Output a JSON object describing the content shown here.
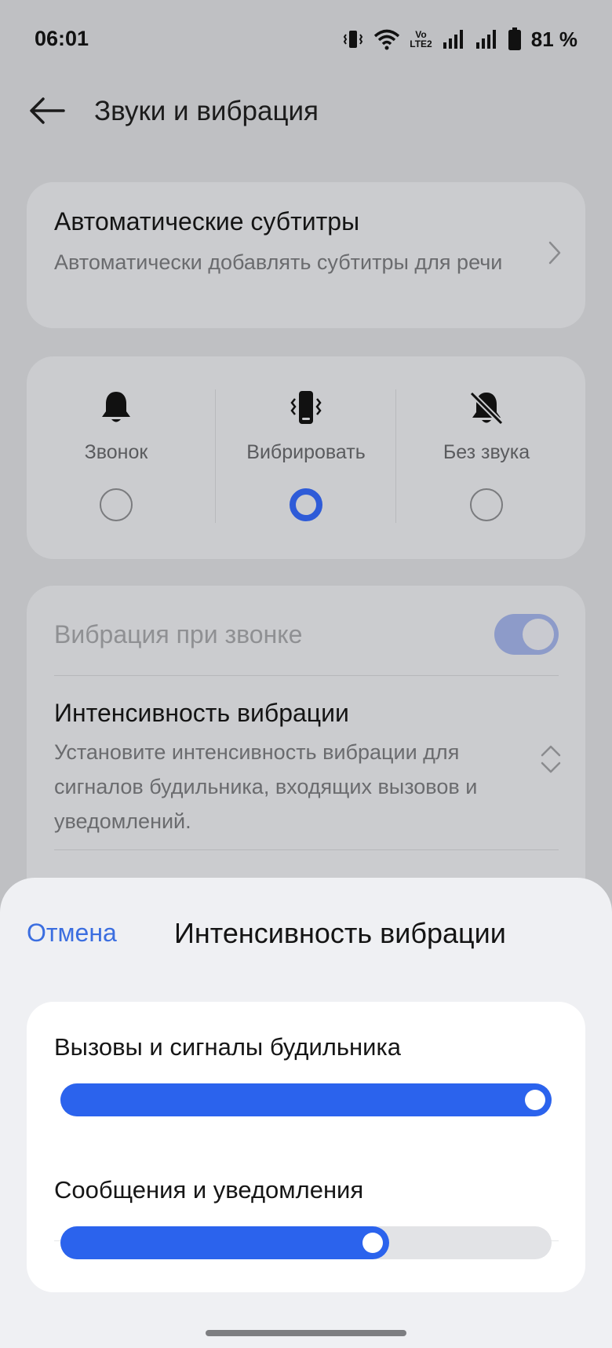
{
  "status_bar": {
    "time": "06:01",
    "volte_top": "Vo",
    "volte_bottom": "LTE2",
    "battery_percent": "81 %",
    "icons": [
      "vibrate-status-icon",
      "wifi-icon",
      "volte-icon",
      "signal-icon",
      "signal-icon",
      "battery-icon"
    ]
  },
  "header": {
    "back_icon": "arrow-left-icon",
    "title": "Звуки и вибрация"
  },
  "auto_subtitles": {
    "title": "Автоматические субтитры",
    "subtitle": "Автоматически добавлять субтитры для речи",
    "icon": "chevron-right-icon"
  },
  "sound_modes": {
    "selected": "Вибрировать",
    "items": [
      {
        "label": "Звонок",
        "icon": "bell-icon",
        "selected": false
      },
      {
        "label": "Вибрировать",
        "icon": "vibrate-icon",
        "selected": true
      },
      {
        "label": "Без звука",
        "icon": "bell-off-icon",
        "selected": false
      }
    ]
  },
  "vibration_settings": {
    "vibrate_on_ring": {
      "label": "Вибрация при звонке",
      "enabled": true,
      "disabled_look": true
    },
    "intensity": {
      "title": "Интенсивность вибрации",
      "subtitle": "Установите интенсивность вибрации для сигналов будильника, входящих вызовов и уведомлений.",
      "icon": "chevron-up-down-icon"
    }
  },
  "sheet": {
    "cancel_label": "Отмена",
    "title": "Интенсивность вибрации",
    "sliders": [
      {
        "label": "Вызовы и сигналы будильника",
        "value_fraction": 1.0
      },
      {
        "label": "Сообщения и уведомления",
        "value_fraction": 0.67
      }
    ]
  },
  "colors": {
    "accent": "#2b63ed",
    "link": "#3b6ee0",
    "backdrop": "#bfc0c3",
    "sheet_bg": "#eff0f3"
  }
}
